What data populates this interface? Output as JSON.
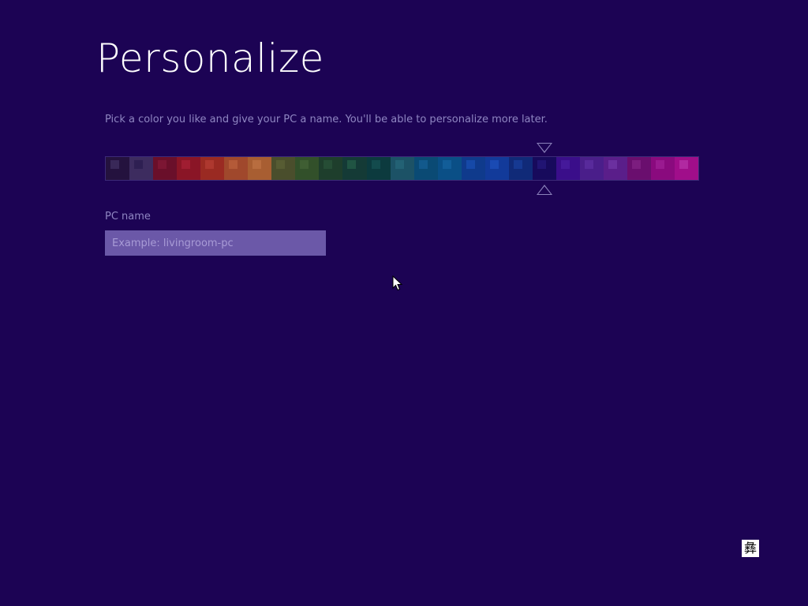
{
  "title": "Personalize",
  "subtitle": "Pick a color you like and give your PC a name. You'll be able to personalize more later.",
  "palette": {
    "selected_index": 18,
    "swatches": [
      {
        "bg": "#24123e",
        "chip": "#4a3a6e"
      },
      {
        "bg": "#3d2c5f",
        "chip": "#231547"
      },
      {
        "bg": "#6a0f2a",
        "chip": "#8a1d3a"
      },
      {
        "bg": "#8a1526",
        "chip": "#b3243a"
      },
      {
        "bg": "#9a2a22",
        "chip": "#c0443a"
      },
      {
        "bg": "#a0482c",
        "chip": "#c56a44"
      },
      {
        "bg": "#a85e32",
        "chip": "#c47a4a"
      },
      {
        "bg": "#4a4e2c",
        "chip": "#62683a"
      },
      {
        "bg": "#32502a",
        "chip": "#4a6a3a"
      },
      {
        "bg": "#1e3e2c",
        "chip": "#2e5a3e"
      },
      {
        "bg": "#143a36",
        "chip": "#2a6a4e"
      },
      {
        "bg": "#0c3a3e",
        "chip": "#1a5a5a"
      },
      {
        "bg": "#1c5266",
        "chip": "#2a6e80"
      },
      {
        "bg": "#0a4a74",
        "chip": "#1a66a0"
      },
      {
        "bg": "#0a4f86",
        "chip": "#1a6aa8"
      },
      {
        "bg": "#0f3a8c",
        "chip": "#1e56c0"
      },
      {
        "bg": "#123a9a",
        "chip": "#2058c8"
      },
      {
        "bg": "#102a78",
        "chip": "#1c46a8"
      },
      {
        "bg": "#170a5c",
        "chip": "#2a1e86"
      },
      {
        "bg": "#3a0e8a",
        "chip": "#4e22a8"
      },
      {
        "bg": "#4a1e8a",
        "chip": "#6434aa"
      },
      {
        "bg": "#5a1e8a",
        "chip": "#7a40b0"
      },
      {
        "bg": "#6a0e6e",
        "chip": "#8a2a8e"
      },
      {
        "bg": "#8a0a7e",
        "chip": "#a8289e"
      },
      {
        "bg": "#a00e8a",
        "chip": "#c040b4"
      }
    ]
  },
  "pc_name": {
    "label": "PC name",
    "value": "",
    "placeholder": "Example: livingroom-pc"
  },
  "ime_indicator": {
    "glyph": "彝"
  }
}
